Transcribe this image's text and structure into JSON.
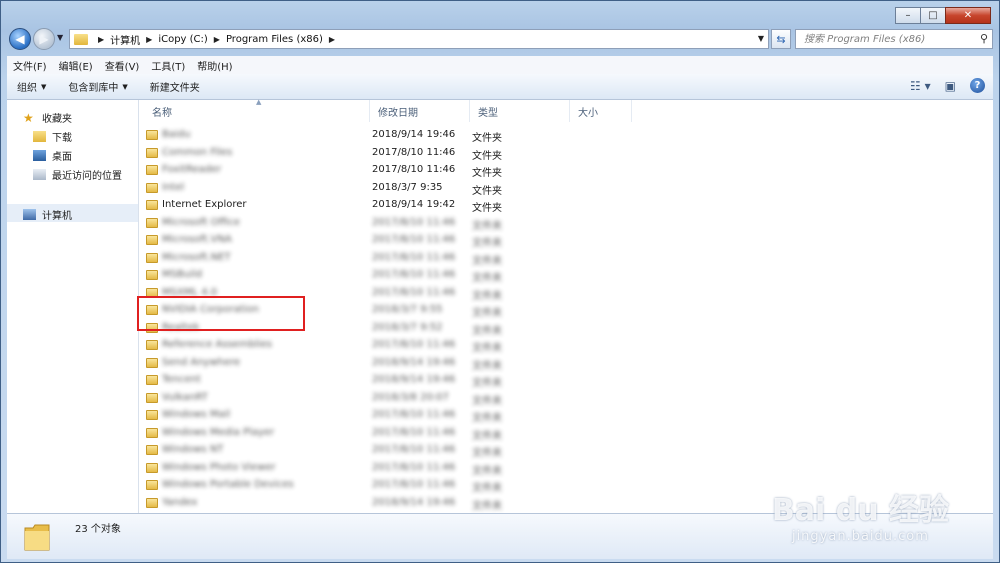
{
  "window": {
    "buttons": {
      "minimize": "–",
      "maximize": "□",
      "close": "✕"
    }
  },
  "address": {
    "crumbs": [
      "计算机",
      "iCopy (C:)",
      "Program Files (x86)"
    ]
  },
  "search": {
    "placeholder": "搜索 Program Files (x86)"
  },
  "menu": [
    "文件(F)",
    "编辑(E)",
    "查看(V)",
    "工具(T)",
    "帮助(H)"
  ],
  "toolbar": {
    "organize": "组织",
    "include_library": "包含到库中",
    "new_folder": "新建文件夹"
  },
  "nav_pane": {
    "favorites": "收藏夹",
    "downloads": "下载",
    "desktop": "桌面",
    "recent": "最近访问的位置",
    "computer": "计算机"
  },
  "columns": {
    "name": "名称",
    "modified": "修改日期",
    "type": "类型",
    "size": "大小"
  },
  "files": [
    {
      "name": "Baidu",
      "date": "2018/9/14 19:46",
      "type": "文件夹",
      "blurred": true,
      "partial": true
    },
    {
      "name": "Common Files",
      "date": "2017/8/10 11:46",
      "type": "文件夹",
      "blurred": true,
      "partial": true
    },
    {
      "name": "FoxitReader",
      "date": "2017/8/10 11:46",
      "type": "文件夹",
      "blurred": true,
      "partial": true
    },
    {
      "name": "Intel",
      "date": "2018/3/7 9:35",
      "type": "文件夹",
      "blurred": true,
      "partial": true
    },
    {
      "name": "Internet Explorer",
      "date": "2018/9/14 19:42",
      "type": "文件夹",
      "blurred": false
    },
    {
      "name": "Microsoft Office",
      "date": "2017/8/10 11:46",
      "type": "文件夹",
      "blurred": true
    },
    {
      "name": "Microsoft.VNA",
      "date": "2017/8/10 11:46",
      "type": "文件夹",
      "blurred": true
    },
    {
      "name": "Microsoft.NET",
      "date": "2017/8/10 11:46",
      "type": "文件夹",
      "blurred": true
    },
    {
      "name": "MSBuild",
      "date": "2017/8/10 11:46",
      "type": "文件夹",
      "blurred": true
    },
    {
      "name": "MSXML 4.0",
      "date": "2017/8/10 11:46",
      "type": "文件夹",
      "blurred": true
    },
    {
      "name": "NVIDIA Corporation",
      "date": "2018/3/7 9:55",
      "type": "文件夹",
      "blurred": true
    },
    {
      "name": "Realtek",
      "date": "2018/3/7 9:52",
      "type": "文件夹",
      "blurred": true
    },
    {
      "name": "Reference Assemblies",
      "date": "2017/8/10 11:46",
      "type": "文件夹",
      "blurred": true
    },
    {
      "name": "Send Anywhere",
      "date": "2018/9/14 19:46",
      "type": "文件夹",
      "blurred": true
    },
    {
      "name": "Tencent",
      "date": "2018/9/14 19:46",
      "type": "文件夹",
      "blurred": true
    },
    {
      "name": "VulkanRT",
      "date": "2018/3/8 20:07",
      "type": "文件夹",
      "blurred": true
    },
    {
      "name": "Windows Mail",
      "date": "2017/8/10 11:46",
      "type": "文件夹",
      "blurred": true
    },
    {
      "name": "Windows Media Player",
      "date": "2017/8/10 11:46",
      "type": "文件夹",
      "blurred": true
    },
    {
      "name": "Windows NT",
      "date": "2017/8/10 11:46",
      "type": "文件夹",
      "blurred": true
    },
    {
      "name": "Windows Photo Viewer",
      "date": "2017/8/10 11:46",
      "type": "文件夹",
      "blurred": true
    },
    {
      "name": "Windows Portable Devices",
      "date": "2017/8/10 11:46",
      "type": "文件夹",
      "blurred": true
    },
    {
      "name": "Yandex",
      "date": "2018/9/14 19:46",
      "type": "文件夹",
      "blurred": true
    }
  ],
  "status": {
    "count": "23 个对象"
  },
  "watermark": {
    "logo": "Bai du 经验",
    "url": "jingyan.baidu.com"
  }
}
